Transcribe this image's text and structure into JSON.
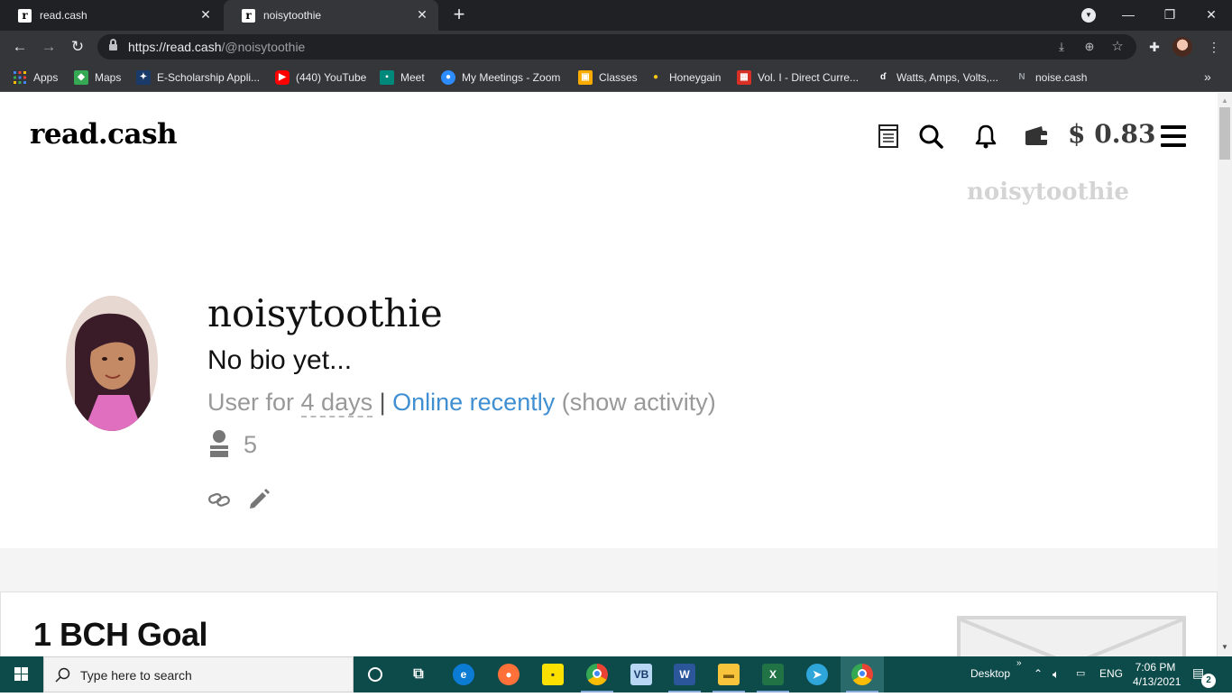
{
  "browser": {
    "tabs": [
      {
        "title": "read.cash",
        "active": false
      },
      {
        "title": "noisytoothie",
        "active": true
      }
    ],
    "url_host": "https://read.cash",
    "url_path": "/@noisytoothie",
    "bookmarks": [
      {
        "label": "Apps",
        "icon": "apps-grid-icon",
        "color": "#4285f4"
      },
      {
        "label": "Maps",
        "icon": "maps-icon",
        "color": "#34a853"
      },
      {
        "label": "E-Scholarship Appli...",
        "icon": "scholarship-icon",
        "color": "#1a73e8"
      },
      {
        "label": "(440) YouTube",
        "icon": "youtube-icon",
        "color": "#ff0000"
      },
      {
        "label": "Meet",
        "icon": "meet-icon",
        "color": "#00897b"
      },
      {
        "label": "My Meetings - Zoom",
        "icon": "zoom-icon",
        "color": "#2d8cff"
      },
      {
        "label": "Classes",
        "icon": "classroom-icon",
        "color": "#f9ab00"
      },
      {
        "label": "Honeygain",
        "icon": "honeygain-icon",
        "color": "#f5c518"
      },
      {
        "label": "Vol. I - Direct Curre...",
        "icon": "vol-icon",
        "color": "#d93025"
      },
      {
        "label": "Watts, Amps, Volts,...",
        "icon": "watts-icon",
        "color": "#444444"
      },
      {
        "label": "noise.cash",
        "icon": "noise-icon",
        "color": "#888888"
      }
    ]
  },
  "site": {
    "logo": "read.cash",
    "balance": "$ 0.83",
    "watermark_name": "noisytoothie"
  },
  "profile": {
    "name": "noisytoothie",
    "bio": "No bio yet...",
    "user_for_prefix": "User for ",
    "user_for_days": "4 days",
    "separator": " | ",
    "online_status": "Online recently",
    "show_activity": " (show activity)",
    "followers": "5"
  },
  "article": {
    "title": "1 BCH Goal"
  },
  "taskbar": {
    "search_placeholder": "Type here to search",
    "desktop_label": "Desktop",
    "language": "ENG",
    "time": "7:06 PM",
    "date": "4/13/2021",
    "notifications": "2"
  }
}
